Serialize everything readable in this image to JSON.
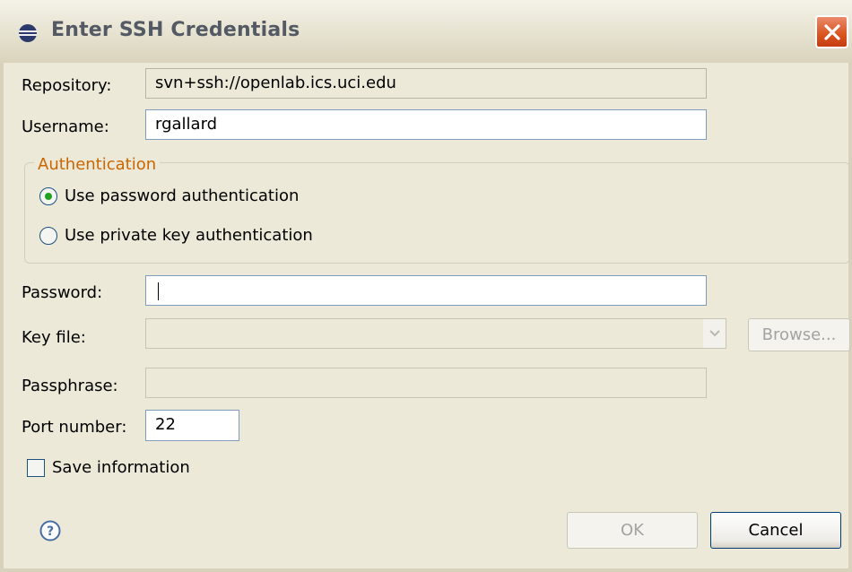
{
  "dialog": {
    "title": "Enter SSH Credentials",
    "accent_color": "#21a121",
    "group_title_color": "#cc6600"
  },
  "icons": {
    "title_icon": "eclipse-icon",
    "close": "close-icon",
    "combo": "chevron-down-icon",
    "help": "help-icon"
  },
  "form": {
    "repository_label": "Repository:",
    "repository_value": "svn+ssh://openlab.ics.uci.edu",
    "username_label": "Username:",
    "username_value": "rgallard",
    "auth_group_title": "Authentication",
    "auth_options": [
      {
        "label": "Use password authentication",
        "selected": true
      },
      {
        "label": "Use private key authentication",
        "selected": false
      }
    ],
    "password_label": "Password:",
    "password_value": "",
    "keyfile_label": "Key file:",
    "keyfile_value": "",
    "browse_label": "Browse...",
    "passphrase_label": "Passphrase:",
    "passphrase_value": "",
    "port_label": "Port number:",
    "port_value": "22",
    "save_label": "Save information",
    "save_checked": false
  },
  "buttons": {
    "ok_label": "OK",
    "cancel_label": "Cancel"
  }
}
